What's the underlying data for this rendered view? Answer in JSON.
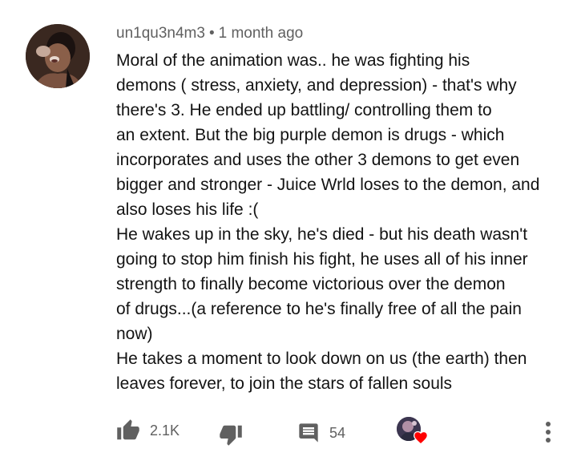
{
  "comment": {
    "author": "un1qu3n4m3",
    "separator": "•",
    "timestamp": "1 month ago",
    "lines": [
      "Moral of the animation was.. he was fighting his",
      "demons ( stress, anxiety, and depression) - that's why",
      "there's 3. He ended up battling/ controlling them to",
      "an extent. But the big purple demon is drugs - which",
      "incorporates and uses the other 3 demons to get even",
      "bigger and stronger - Juice Wrld loses to the demon, and",
      "also loses his life :(",
      "He wakes up in the sky, he's died - but his death wasn't",
      "going to stop him finish his fight, he uses all of his inner",
      "strength to finally become victorious over the demon",
      "of drugs...(a reference to he's finally free of all the pain",
      "now)",
      "He takes a moment to look down on us (the earth) then",
      "leaves forever, to join the stars of fallen souls"
    ]
  },
  "actions": {
    "likes": "2.1K",
    "replies": "54",
    "like_icon": "thumb-up-icon",
    "dislike_icon": "thumb-down-icon",
    "reply_icon": "comment-icon",
    "heart_icon": "heart-icon",
    "menu_icon": "more-vertical-icon"
  },
  "colors": {
    "text": "#131313",
    "secondary": "#606060",
    "icon": "#606060",
    "heart": "#ff0000"
  }
}
